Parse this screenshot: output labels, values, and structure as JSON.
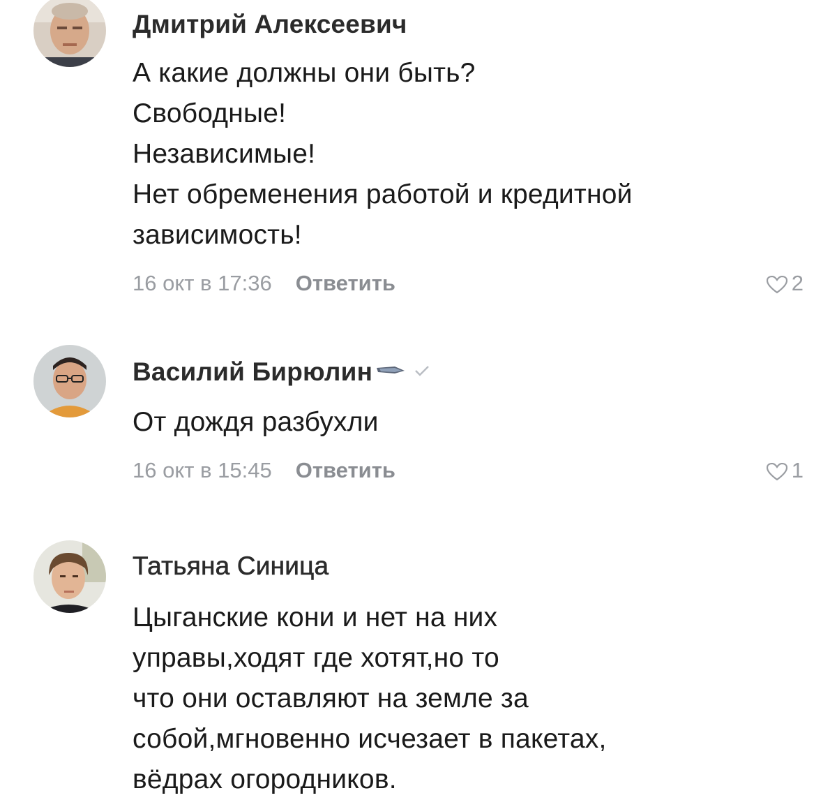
{
  "comments": [
    {
      "author": "Дмитрий Алексеевич",
      "lines": [
        "А какие должны они быть?",
        "Свободные!",
        "Независимые!",
        "Нет обременения работой и кредитной",
        "зависимость!"
      ],
      "time": "16 окт в 17:36",
      "reply_label": "Ответить",
      "likes": "2"
    },
    {
      "author": "Василий Бирюлин",
      "lines": [
        "От дождя разбухли"
      ],
      "time": "16 окт в 15:45",
      "reply_label": "Ответить",
      "likes": "1"
    },
    {
      "author": "Татьяна Синица",
      "lines": [
        "Цыганские кони и нет на них",
        "управы,ходят где хотят,но то",
        "что они оставляют на земле за",
        "собой,мгновенно исчезает в пакетах,",
        "вёдрах огородников."
      ]
    }
  ],
  "icons": {
    "heart": "heart-outline-icon",
    "verified": "checkmark-icon",
    "badge": "feather-badge-icon"
  },
  "colors": {
    "meta": "#9a9da2",
    "text": "#1a1a1a"
  }
}
